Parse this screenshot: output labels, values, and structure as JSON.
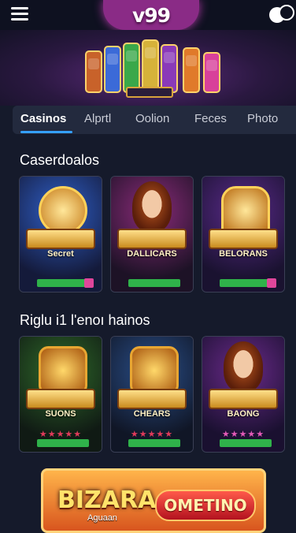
{
  "header": {
    "logo": "v99",
    "menu_icon": "hamburger-icon",
    "toggle_icon": "theme-toggle-icon"
  },
  "tabs": [
    {
      "label": "Casinos",
      "active": true
    },
    {
      "label": "Alprtl",
      "active": false
    },
    {
      "label": "Oolion",
      "active": false
    },
    {
      "label": "Feces",
      "active": false
    },
    {
      "label": "Photo",
      "active": false
    }
  ],
  "sections": [
    {
      "title": "Caserdoalos",
      "cards": [
        {
          "title": "Secret",
          "stars": "",
          "accent": "#3b6fd1"
        },
        {
          "title": "DALLICARS",
          "stars": "",
          "accent": "#8b2b7a"
        },
        {
          "title": "BELORANS",
          "stars": "",
          "accent": "#5a2a8a"
        }
      ]
    },
    {
      "title": "Riglu i1 l'enoı hainos",
      "cards": [
        {
          "title": "SUONS",
          "stars": "★★★★★",
          "accent": "#2f6a2a"
        },
        {
          "title": "CHEARS",
          "stars": "★★★★★",
          "accent": "#2a4f8a"
        },
        {
          "title": "BAONG",
          "stars": "★★★★★",
          "accent": "#6a2a8a"
        }
      ]
    }
  ],
  "banner": {
    "title": "BIZARA",
    "button_label": "OMETINO",
    "subtitle": "Aguaan"
  },
  "colors": {
    "accent": "#35a0ff",
    "logo_bg": "#8a2b86",
    "play_button": "#2fb24a"
  }
}
